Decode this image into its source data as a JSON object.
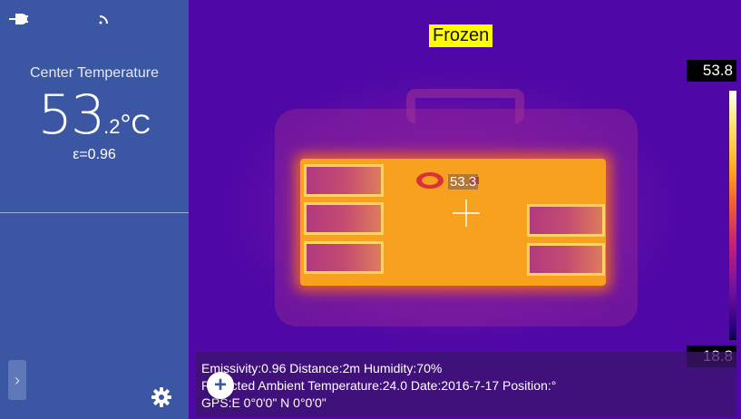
{
  "sidebar": {
    "center_label": "Center Temperature",
    "temp_integer": "53",
    "temp_decimal": ".2",
    "temp_unit": "°C",
    "emissivity": "ε=0.96",
    "expand_glyph": "›"
  },
  "thermal": {
    "badge": "Frozen",
    "spot_value": "53.3",
    "scale_max": "53.8",
    "scale_min": "18.8"
  },
  "info": {
    "line1": "Emissivity:0.96  Distance:2m  Humidity:70%",
    "line2": "Reflected Ambient Temperature:24.0  Date:2016-7-17  Position:°",
    "line3": "GPS:E 0°0'0\" N 0°0'0\""
  },
  "fab": {
    "glyph": "+"
  },
  "icons": [
    "plug-icon",
    "wifi-icon",
    "gear-icon",
    "crosshair-icon",
    "chevron-right-icon",
    "brand-logo-icon"
  ],
  "colors": {
    "sidebar": "#3b57a3",
    "badge": "#ffff00",
    "hot": "#f7a11f",
    "cold": "#4f08a6"
  }
}
